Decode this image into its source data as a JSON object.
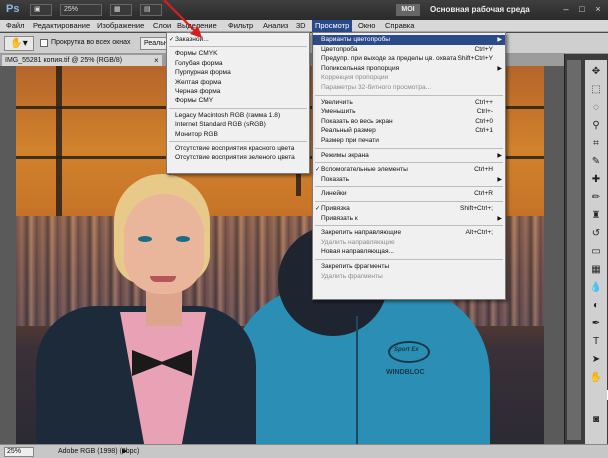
{
  "titlebar": {
    "app_logo": "Ps",
    "zoom": "25%",
    "mode_button": "МОІ",
    "workspace": "Основная рабочая среда",
    "icons": [
      "window-minimize-icon",
      "window-restore-icon",
      "window-close-icon"
    ]
  },
  "menubar": {
    "items": [
      "Файл",
      "Редактирование",
      "Изображение",
      "Слои",
      "Выделение",
      "Фильтр",
      "Анализ",
      "3D",
      "Просмотр",
      "Окно",
      "Справка"
    ],
    "active": "Просмотр"
  },
  "options": {
    "scroll_all_label": "Прокрутка во всех окнах",
    "actual_pixels_label": "Реальные"
  },
  "document": {
    "tab_label": "IMG_55281 копия.tif @ 25% (RGB/8)",
    "close": "×",
    "photo_logo_text": "Sport Ex",
    "photo_brand_text": "WINDBLOC"
  },
  "proof_menu": {
    "items": [
      {
        "label": "Заказной...",
        "checked": true
      },
      {
        "sep": true
      },
      {
        "label": "Формы CMYK"
      },
      {
        "label": "Голубая форма"
      },
      {
        "label": "Пурпурная форма"
      },
      {
        "label": "Желтая форма"
      },
      {
        "label": "Черная форма"
      },
      {
        "label": "Формы CMY"
      },
      {
        "sep": true
      },
      {
        "label": "Legacy Macintosh RGB (гамма 1.8)"
      },
      {
        "label": "Internet Standard RGB (sRGB)"
      },
      {
        "label": "Монитор RGB"
      },
      {
        "sep": true
      },
      {
        "label": "Отсутствие восприятия красного цвета"
      },
      {
        "label": "Отсутствие восприятия зеленого цвета"
      }
    ]
  },
  "view_menu": {
    "items": [
      {
        "label": "Варианты цветопробы",
        "submenu": true,
        "highlight": true
      },
      {
        "label": "Цветопроба",
        "shortcut": "Ctrl+Y"
      },
      {
        "label": "Предупр. при выходе за пределы цв. охвата",
        "shortcut": "Shift+Ctrl+Y"
      },
      {
        "label": "Попиксельная пропорция",
        "submenu": true
      },
      {
        "label": "Коррекция пропорции",
        "disabled": true
      },
      {
        "label": "Параметры 32-битного просмотра...",
        "disabled": true
      },
      {
        "sep": true
      },
      {
        "label": "Увеличить",
        "shortcut": "Ctrl++"
      },
      {
        "label": "Уменьшить",
        "shortcut": "Ctrl+-"
      },
      {
        "label": "Показать во весь экран",
        "shortcut": "Ctrl+0"
      },
      {
        "label": "Реальный размер",
        "shortcut": "Ctrl+1"
      },
      {
        "label": "Размер при печати"
      },
      {
        "sep": true
      },
      {
        "label": "Режимы экрана",
        "submenu": true
      },
      {
        "sep": true
      },
      {
        "label": "Вспомогательные элементы",
        "shortcut": "Ctrl+H",
        "checked": true
      },
      {
        "label": "Показать",
        "submenu": true
      },
      {
        "sep": true
      },
      {
        "label": "Линейки",
        "shortcut": "Ctrl+R"
      },
      {
        "sep": true
      },
      {
        "label": "Привязка",
        "shortcut": "Shift+Ctrl+;",
        "checked": true
      },
      {
        "label": "Привязать к",
        "submenu": true
      },
      {
        "sep": true
      },
      {
        "label": "Закрепить направляющие",
        "shortcut": "Alt+Ctrl+;"
      },
      {
        "label": "Удалить направляющие",
        "disabled": true
      },
      {
        "label": "Новая направляющая..."
      },
      {
        "sep": true
      },
      {
        "label": "Закрепить фрагменты"
      },
      {
        "label": "Удалить фрагменты",
        "disabled": true
      }
    ]
  },
  "statusbar": {
    "zoom": "25%",
    "info": "Adobe RGB (1998) (8bpc)",
    "arrow": "▶"
  },
  "colors": {
    "menu_highlight": "#2b4a8a",
    "annotation_arrow": "#d62020",
    "foreground": "#000000",
    "background": "#ffffff"
  }
}
